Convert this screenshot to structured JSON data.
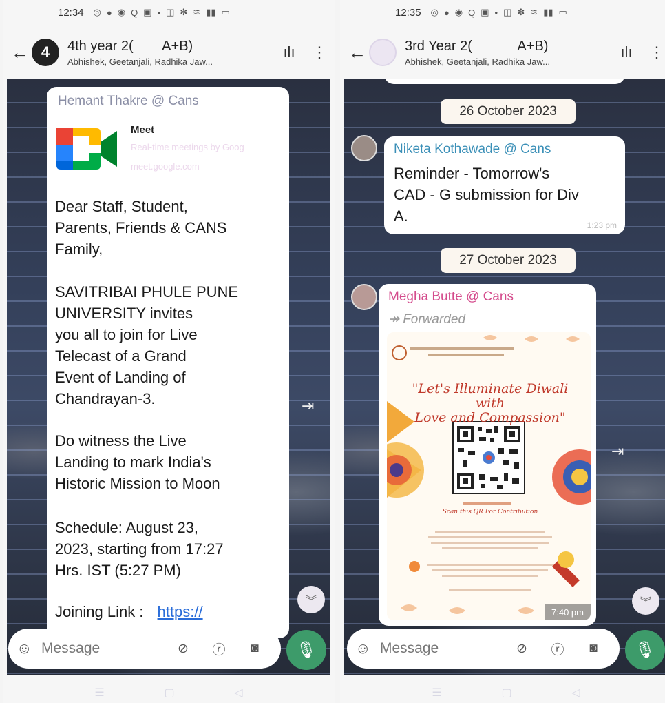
{
  "left": {
    "status_time": "12:34",
    "header": {
      "badge": "4",
      "title": "4th year 2(",
      "title_suffix": "A+B)",
      "subtitle": "Abhishek, Geetanjali, Radhika Jaw..."
    },
    "message": {
      "sender": "Hemant Thakre @ Cans",
      "link_title": "Meet",
      "link_desc": "Real-time meetings by Goog",
      "link_domain": "meet.google.com",
      "paragraphs": [
        "Dear  Staff, Student,\nParents, Friends & CANS\nFamily,",
        "SAVITRIBAI  PHULE  PUNE\nUNIVERSITY  invites\nyou all to join for Live\nTelecast  of  a  Grand\nEvent  of  Landing  of\nChandrayan-3.",
        " Do  witness the Live\nLanding to mark India's\nHistoric Mission to Moon",
        "Schedule:  August 23,\n2023, starting from 17:27\nHrs. IST (5:27 PM)"
      ],
      "joining_label": "Joining  Link :",
      "joining_link": "https://"
    },
    "compose_placeholder": "Message"
  },
  "right": {
    "status_time": "12:35",
    "header": {
      "title": "3rd Year 2(",
      "title_suffix": "A+B)",
      "subtitle": "Abhishek, Geetanjali, Radhika Jaw..."
    },
    "date1": "26 October 2023",
    "msg1": {
      "sender": "Niketa Kothawade @ Cans",
      "text": "Reminder - Tomorrow's\nCAD - G submission for Div\nA.",
      "time": "1:23 pm"
    },
    "date2": "27 October 2023",
    "msg2": {
      "sender": "Megha Butte @ Cans",
      "forwarded": "Forwarded",
      "poster_title": "\"Let's Illuminate Diwali with\nLove and Compassion\"",
      "poster_caption": "Scan this QR For Contribution",
      "time": "7:40 pm"
    },
    "compose_placeholder": "Message"
  },
  "colors": {
    "sender_left": "#8b8fa6",
    "sender_niketa": "#3a8fb7",
    "sender_megha": "#d44b8c",
    "link": "#2a6dd9",
    "mic": "#3d9b6a"
  }
}
